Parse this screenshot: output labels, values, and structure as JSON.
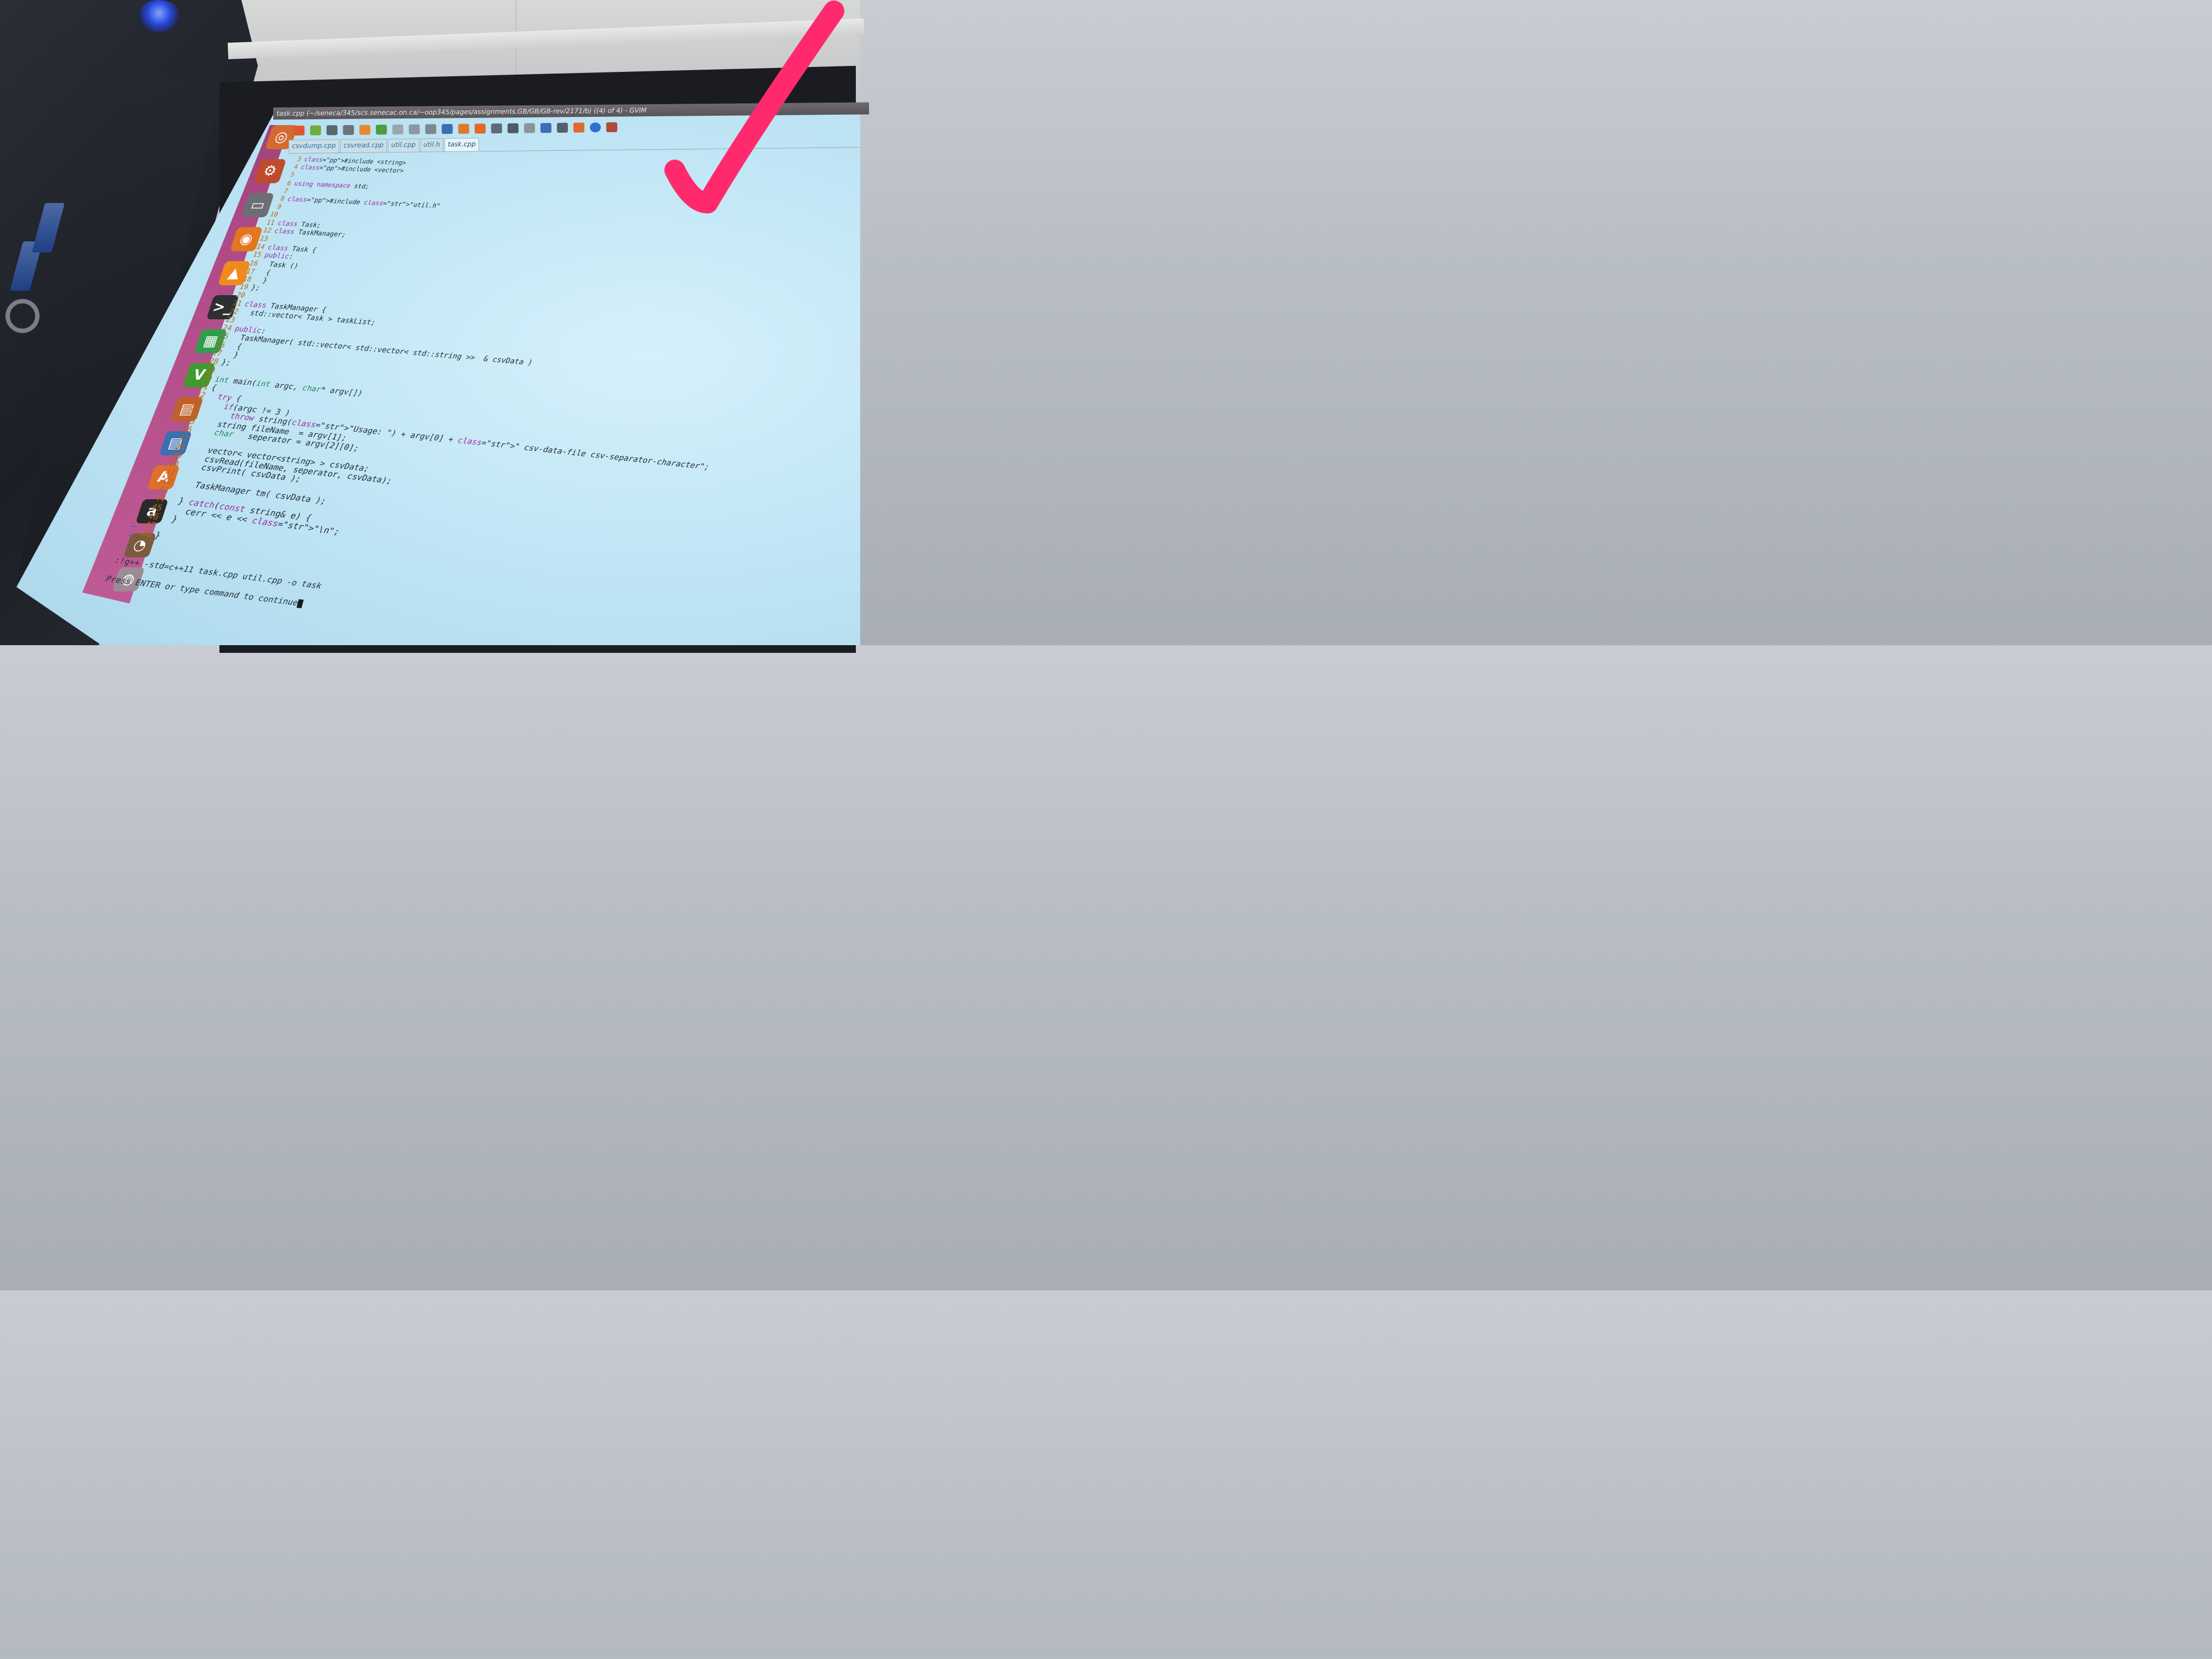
{
  "window": {
    "title": "task.cpp (~/seneca/345/scs.senecac.on.ca/~oop345/pages/assignments.GB/GB/GB-rev/2171/b) ((4) of 4) - GVIM"
  },
  "tabs": [
    "csvdump.cpp",
    "csvread.cpp",
    "util.cpp",
    "util.h",
    "task.cpp"
  ],
  "active_tab": "task.cpp",
  "toolbar_icons": [
    "open-icon",
    "save-icon",
    "save-all-icon",
    "print-icon",
    "undo-icon",
    "redo-icon",
    "cut-icon",
    "copy-icon",
    "paste-icon",
    "find-replace-icon",
    "find-next-icon",
    "find-prev-icon",
    "load-session-icon",
    "save-session-icon",
    "run-script-icon",
    "make-icon",
    "shell-icon",
    "ctags-icon",
    "help-icon",
    "find-help-icon"
  ],
  "launcher_icons": [
    "ubuntu-dash-icon",
    "system-settings-icon",
    "files-icon",
    "firefox-icon",
    "vlc-icon",
    "terminal-icon",
    "libreoffice-calc-icon",
    "gvim-icon",
    "libreoffice-impress-icon",
    "libreoffice-writer-icon",
    "software-center-icon",
    "amazon-icon",
    "image-viewer-icon",
    "trash-icon"
  ],
  "code_lines": [
    {
      "n": "3",
      "t": "#include <string>"
    },
    {
      "n": "4",
      "t": "#include <vector>"
    },
    {
      "n": "5",
      "t": ""
    },
    {
      "n": "6",
      "t": "using namespace std;"
    },
    {
      "n": "7",
      "t": ""
    },
    {
      "n": "8",
      "t": "#include \"util.h\""
    },
    {
      "n": "9",
      "t": ""
    },
    {
      "n": "10",
      "t": ""
    },
    {
      "n": "11",
      "t": "class Task;"
    },
    {
      "n": "12",
      "t": "class TaskManager;"
    },
    {
      "n": "13",
      "t": ""
    },
    {
      "n": "14",
      "t": "class Task {"
    },
    {
      "n": "15",
      "t": "public:"
    },
    {
      "n": "16",
      "t": "  Task ()"
    },
    {
      "n": "17",
      "t": "  {"
    },
    {
      "n": "18",
      "t": "  }"
    },
    {
      "n": "19",
      "t": "};"
    },
    {
      "n": "20",
      "t": ""
    },
    {
      "n": "21",
      "t": "class TaskManager {"
    },
    {
      "n": "22",
      "t": "  std::vector< Task > taskList;"
    },
    {
      "n": "23",
      "t": ""
    },
    {
      "n": "24",
      "t": "public:"
    },
    {
      "n": "25",
      "t": "  TaskManager( std::vector< std::vector< std::string >>  & csvData )"
    },
    {
      "n": "26",
      "t": "  {"
    },
    {
      "n": "27",
      "t": "  }"
    },
    {
      "n": "28",
      "t": "};"
    },
    {
      "n": "29",
      "t": ""
    },
    {
      "n": "30",
      "t": "int main(int argc, char* argv[])"
    },
    {
      "n": "31",
      "t": "{"
    },
    {
      "n": "32",
      "t": "  try {"
    },
    {
      "n": "33",
      "t": "    if(argc != 3 )"
    },
    {
      "n": "34",
      "t": "      throw string(\"Usage: \") + argv[0] + \" csv-data-file csv-separator-character\";"
    },
    {
      "n": "35",
      "t": "    string fileName  = argv[1];"
    },
    {
      "n": "36",
      "t": "    char   seperator = argv[2][0];"
    },
    {
      "n": "37",
      "t": ""
    },
    {
      "n": "38",
      "t": "    vector< vector<string> > csvData;"
    },
    {
      "n": "39",
      "t": "    csvRead(fileName, seperator, csvData);"
    },
    {
      "n": "40",
      "t": "    csvPrint( csvData );"
    },
    {
      "n": "41",
      "t": ""
    },
    {
      "n": "42",
      "t": "    TaskManager tm( csvData );"
    },
    {
      "n": "43",
      "t": ""
    },
    {
      "n": "44",
      "t": "  } catch(const string& e) {"
    },
    {
      "n": "45",
      "t": "    cerr << e << \"\\n\";"
    },
    {
      "n": "46",
      "t": "  }"
    },
    {
      "n": "47",
      "t": ""
    },
    {
      "n": "48",
      "t": "}"
    }
  ],
  "tilde_lines": [
    "~",
    "~",
    "~",
    "~"
  ],
  "command_line": ":!g++ -std=c++11 task.cpp util.cpp -o task",
  "prompt": "Press ENTER or type command to continue",
  "colors": {
    "checkmark": "#ff2a6d",
    "launcher": "#b14b87",
    "screen": "#c1e6f5"
  }
}
